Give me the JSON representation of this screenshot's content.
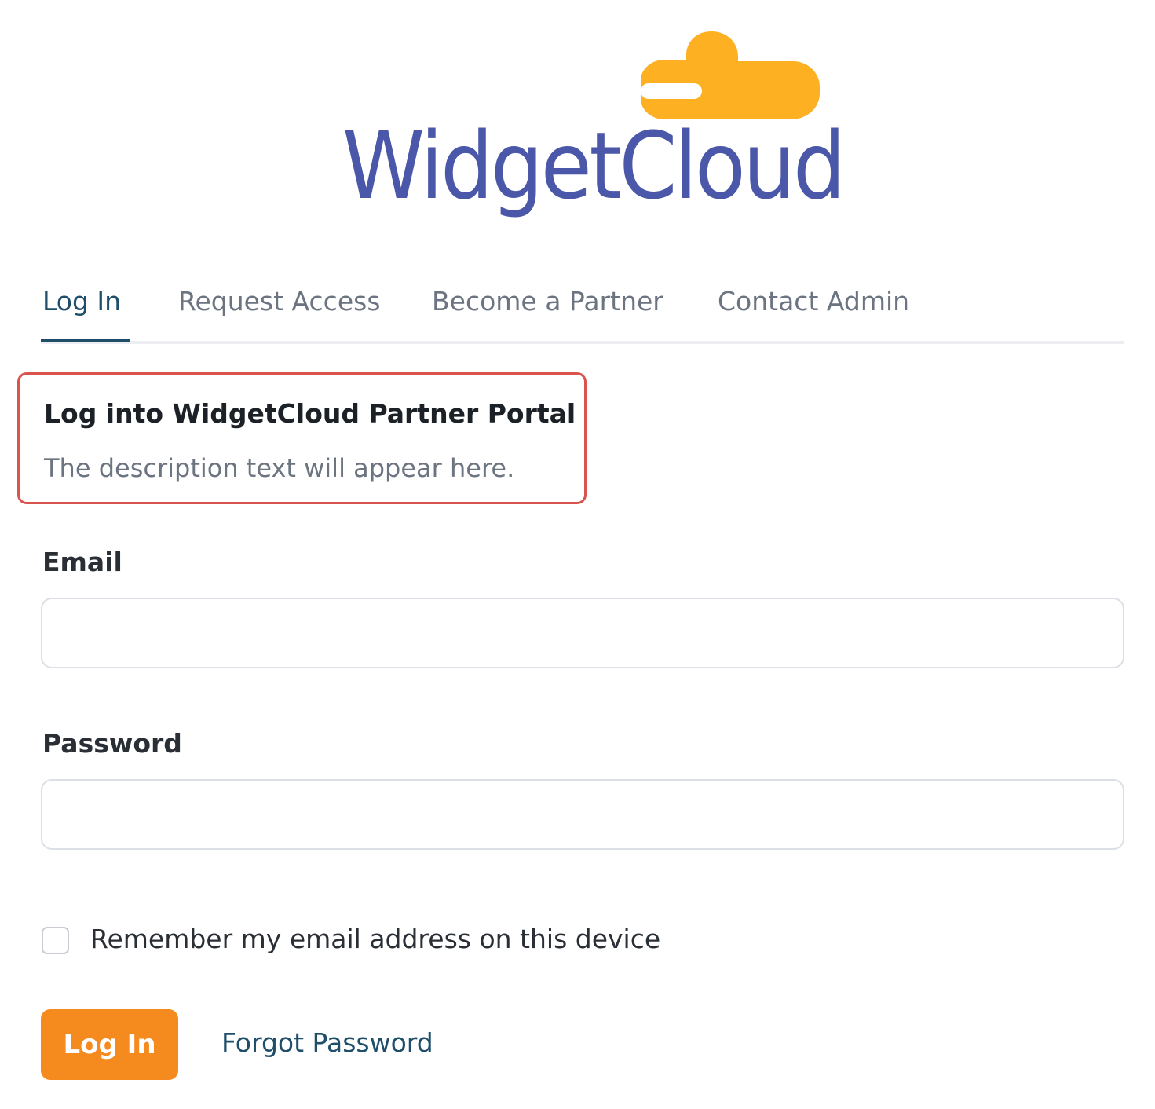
{
  "brand": {
    "name": "WidgetCloud",
    "text_color": "#4b57a8",
    "cloud_color": "#fdb022"
  },
  "tabs": [
    {
      "label": "Log In",
      "active": true
    },
    {
      "label": "Request Access",
      "active": false
    },
    {
      "label": "Become a Partner",
      "active": false
    },
    {
      "label": "Contact Admin",
      "active": false
    }
  ],
  "intro": {
    "title": "Log into WidgetCloud Partner Portal",
    "description": "The description text will appear here.",
    "highlight_color": "#d9534f"
  },
  "form": {
    "email_label": "Email",
    "email_value": "",
    "password_label": "Password",
    "password_value": "",
    "remember_label": "Remember my email address on this device",
    "remember_checked": false,
    "submit_label": "Log In",
    "submit_color": "#f58a1f",
    "forgot_label": "Forgot Password"
  }
}
